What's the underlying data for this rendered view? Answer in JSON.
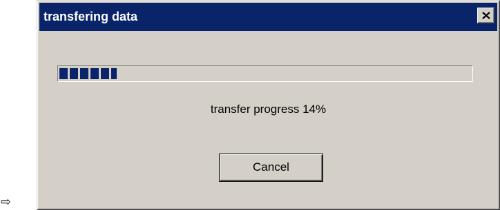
{
  "window": {
    "title": "transfering data",
    "close_icon": "close-icon"
  },
  "progress": {
    "percent": 14,
    "label": "transfer progress 14%"
  },
  "buttons": {
    "cancel_label": "Cancel"
  },
  "pointer": {
    "glyph": "⇨"
  },
  "colors": {
    "titlebar": "#0a246a",
    "dialog_face": "#d4d0c8",
    "progress_fill": "#0a246a"
  }
}
